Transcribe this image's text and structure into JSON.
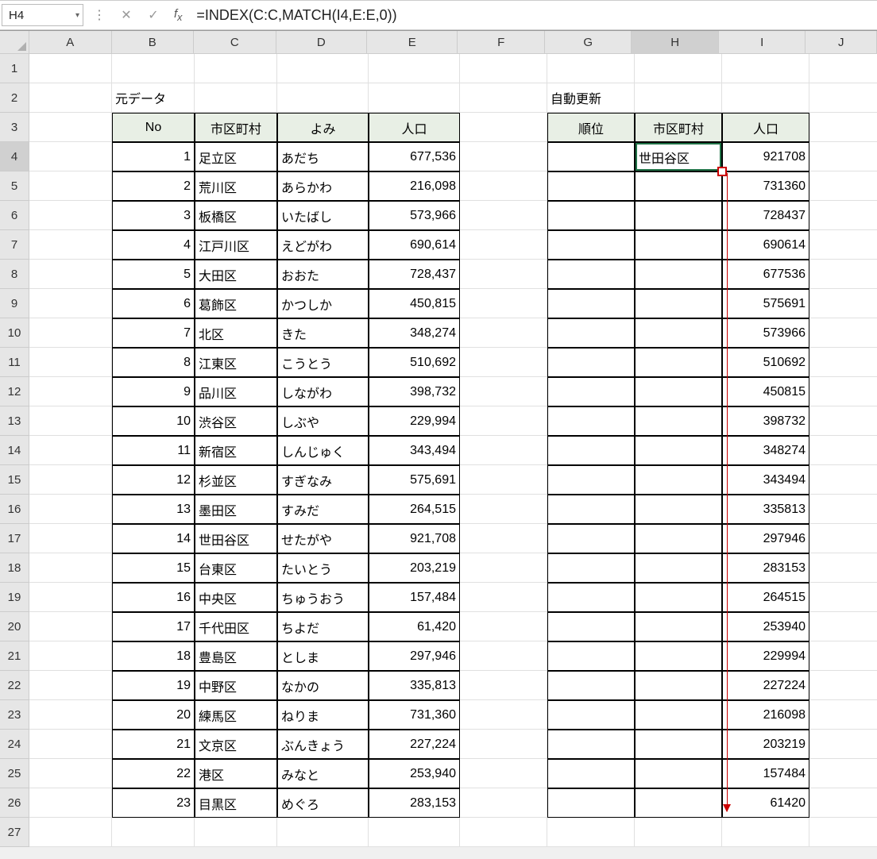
{
  "name_box": "H4",
  "formula": "=INDEX(C:C,MATCH(I4,E:E,0))",
  "cols": [
    "A",
    "B",
    "C",
    "D",
    "E",
    "F",
    "G",
    "H",
    "I",
    "J"
  ],
  "active_col": "H",
  "active_row": 4,
  "labels": {
    "src": "元データ",
    "auto": "自動更新",
    "no": "No",
    "city": "市区町村",
    "yomi": "よみ",
    "pop": "人口",
    "rank": "順位"
  },
  "src_rows": [
    {
      "no": "1",
      "city": "足立区",
      "yomi": "あだち",
      "pop": "677,536"
    },
    {
      "no": "2",
      "city": "荒川区",
      "yomi": "あらかわ",
      "pop": "216,098"
    },
    {
      "no": "3",
      "city": "板橋区",
      "yomi": "いたばし",
      "pop": "573,966"
    },
    {
      "no": "4",
      "city": "江戸川区",
      "yomi": "えどがわ",
      "pop": "690,614"
    },
    {
      "no": "5",
      "city": "大田区",
      "yomi": "おおた",
      "pop": "728,437"
    },
    {
      "no": "6",
      "city": "葛飾区",
      "yomi": "かつしか",
      "pop": "450,815"
    },
    {
      "no": "7",
      "city": "北区",
      "yomi": "きた",
      "pop": "348,274"
    },
    {
      "no": "8",
      "city": "江東区",
      "yomi": "こうとう",
      "pop": "510,692"
    },
    {
      "no": "9",
      "city": "品川区",
      "yomi": "しながわ",
      "pop": "398,732"
    },
    {
      "no": "10",
      "city": "渋谷区",
      "yomi": "しぶや",
      "pop": "229,994"
    },
    {
      "no": "11",
      "city": "新宿区",
      "yomi": "しんじゅく",
      "pop": "343,494"
    },
    {
      "no": "12",
      "city": "杉並区",
      "yomi": "すぎなみ",
      "pop": "575,691"
    },
    {
      "no": "13",
      "city": "墨田区",
      "yomi": "すみだ",
      "pop": "264,515"
    },
    {
      "no": "14",
      "city": "世田谷区",
      "yomi": "せたがや",
      "pop": "921,708"
    },
    {
      "no": "15",
      "city": "台東区",
      "yomi": "たいとう",
      "pop": "203,219"
    },
    {
      "no": "16",
      "city": "中央区",
      "yomi": "ちゅうおう",
      "pop": "157,484"
    },
    {
      "no": "17",
      "city": "千代田区",
      "yomi": "ちよだ",
      "pop": "61,420"
    },
    {
      "no": "18",
      "city": "豊島区",
      "yomi": "としま",
      "pop": "297,946"
    },
    {
      "no": "19",
      "city": "中野区",
      "yomi": "なかの",
      "pop": "335,813"
    },
    {
      "no": "20",
      "city": "練馬区",
      "yomi": "ねりま",
      "pop": "731,360"
    },
    {
      "no": "21",
      "city": "文京区",
      "yomi": "ぶんきょう",
      "pop": "227,224"
    },
    {
      "no": "22",
      "city": "港区",
      "yomi": "みなと",
      "pop": "253,940"
    },
    {
      "no": "23",
      "city": "目黒区",
      "yomi": "めぐろ",
      "pop": "283,153"
    }
  ],
  "sort_rows": [
    {
      "city": "世田谷区",
      "pop": "921708"
    },
    {
      "city": "",
      "pop": "731360"
    },
    {
      "city": "",
      "pop": "728437"
    },
    {
      "city": "",
      "pop": "690614"
    },
    {
      "city": "",
      "pop": "677536"
    },
    {
      "city": "",
      "pop": "575691"
    },
    {
      "city": "",
      "pop": "573966"
    },
    {
      "city": "",
      "pop": "510692"
    },
    {
      "city": "",
      "pop": "450815"
    },
    {
      "city": "",
      "pop": "398732"
    },
    {
      "city": "",
      "pop": "348274"
    },
    {
      "city": "",
      "pop": "343494"
    },
    {
      "city": "",
      "pop": "335813"
    },
    {
      "city": "",
      "pop": "297946"
    },
    {
      "city": "",
      "pop": "283153"
    },
    {
      "city": "",
      "pop": "264515"
    },
    {
      "city": "",
      "pop": "253940"
    },
    {
      "city": "",
      "pop": "229994"
    },
    {
      "city": "",
      "pop": "227224"
    },
    {
      "city": "",
      "pop": "216098"
    },
    {
      "city": "",
      "pop": "203219"
    },
    {
      "city": "",
      "pop": "157484"
    },
    {
      "city": "",
      "pop": "61420"
    }
  ]
}
